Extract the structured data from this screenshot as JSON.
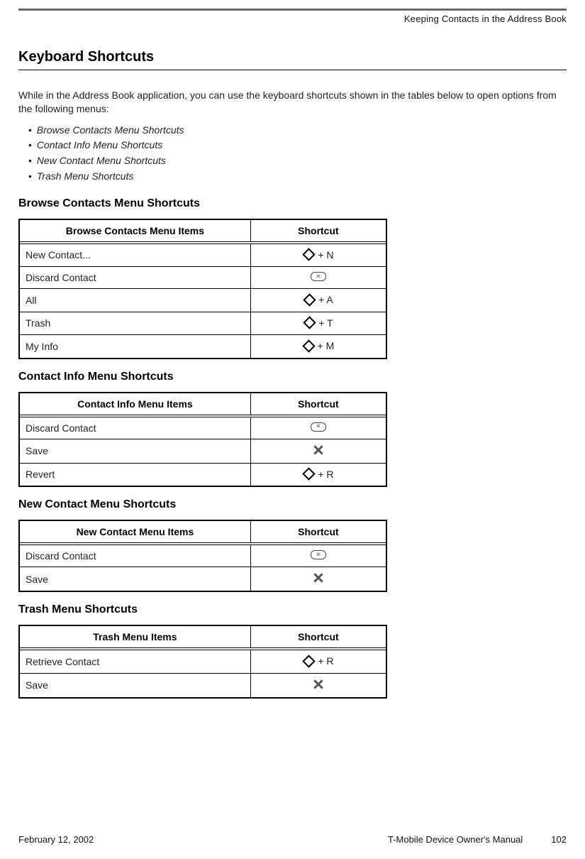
{
  "header": {
    "breadcrumb": "Keeping Contacts in the Address Book"
  },
  "title": "Keyboard Shortcuts",
  "intro": "While in the Address Book application, you can use the keyboard shortcuts shown in the tables below to open options from the following menus:",
  "menu_list": [
    "Browse Contacts Menu Shortcuts",
    "Contact Info Menu Shortcuts",
    "New Contact Menu Shortcuts",
    "Trash Menu Shortcuts"
  ],
  "tables": [
    {
      "heading": "Browse Contacts Menu Shortcuts",
      "col1": "Browse Contacts Menu Items",
      "col2": "Shortcut",
      "rows": [
        {
          "item": "New Contact...",
          "icon": "diamond",
          "suffix": " + N"
        },
        {
          "item": "Discard Contact",
          "icon": "delete",
          "suffix": ""
        },
        {
          "item": "All",
          "icon": "diamond",
          "suffix": " + A"
        },
        {
          "item": "Trash",
          "icon": "diamond",
          "suffix": " + T"
        },
        {
          "item": "My Info",
          "icon": "diamond",
          "suffix": " + M"
        }
      ]
    },
    {
      "heading": "Contact Info Menu Shortcuts",
      "col1": "Contact Info Menu Items",
      "col2": "Shortcut",
      "rows": [
        {
          "item": "Discard Contact",
          "icon": "delete",
          "suffix": ""
        },
        {
          "item": "Save",
          "icon": "x",
          "suffix": ""
        },
        {
          "item": "Revert",
          "icon": "diamond",
          "suffix": " + R"
        }
      ]
    },
    {
      "heading": "New Contact Menu Shortcuts",
      "col1": "New Contact Menu Items",
      "col2": "Shortcut",
      "rows": [
        {
          "item": "Discard Contact",
          "icon": "delete",
          "suffix": ""
        },
        {
          "item": "Save",
          "icon": "x",
          "suffix": ""
        }
      ]
    },
    {
      "heading": "Trash Menu Shortcuts",
      "col1": "Trash Menu Items",
      "col2": "Shortcut",
      "rows": [
        {
          "item": "Retrieve Contact",
          "icon": "diamond",
          "suffix": " + R"
        },
        {
          "item": "Save",
          "icon": "x",
          "suffix": ""
        }
      ]
    }
  ],
  "footer": {
    "date": "February 12, 2002",
    "manual": "T-Mobile Device Owner's Manual",
    "page": "102"
  }
}
